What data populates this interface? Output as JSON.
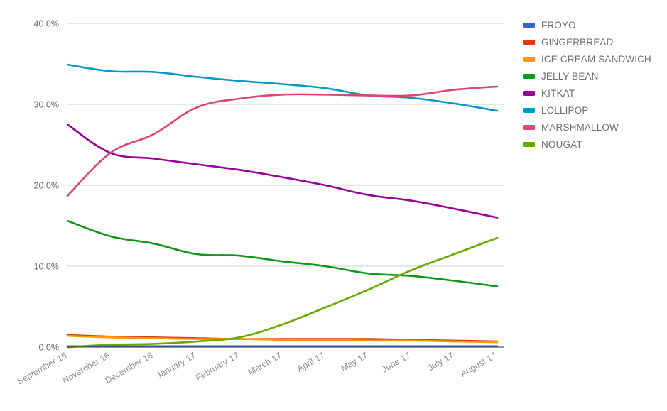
{
  "chart_data": {
    "type": "line",
    "title": "",
    "subtitle": "",
    "xlabel": "",
    "ylabel": "",
    "ylim": [
      0,
      40
    ],
    "ytick_labels": [
      "0.0%",
      "10.0%",
      "20.0%",
      "30.0%",
      "40.0%"
    ],
    "ytick_values": [
      0,
      10,
      20,
      30,
      40
    ],
    "grid": true,
    "legend_position": "right",
    "categories": [
      "September 16",
      "November 16",
      "December 16",
      "January 17",
      "February 17",
      "March 17",
      "April 17",
      "May 17",
      "June 17",
      "July 17",
      "August 17"
    ],
    "series": [
      {
        "name": "FROYO",
        "color": "#3366cc",
        "values": [
          0.1,
          0.1,
          0.1,
          0.1,
          0.1,
          0.1,
          0.1,
          0.1,
          0.1,
          0.1,
          0.1
        ]
      },
      {
        "name": "GINGERBREAD",
        "color": "#dc3912",
        "values": [
          1.5,
          1.3,
          1.2,
          1.1,
          1.0,
          1.0,
          1.0,
          1.0,
          0.9,
          0.8,
          0.7
        ]
      },
      {
        "name": "ICE CREAM SANDWICH",
        "color": "#ff9900",
        "values": [
          1.4,
          1.2,
          1.1,
          1.0,
          1.0,
          0.9,
          0.9,
          0.8,
          0.8,
          0.7,
          0.6
        ]
      },
      {
        "name": "JELLY BEAN",
        "color": "#109618",
        "values": [
          15.6,
          13.7,
          12.8,
          11.5,
          11.3,
          10.6,
          10.0,
          9.1,
          8.8,
          8.2,
          7.5
        ]
      },
      {
        "name": "KITKAT",
        "color": "#990099",
        "values": [
          27.5,
          24.0,
          23.3,
          22.6,
          21.9,
          21.0,
          20.0,
          18.8,
          18.1,
          17.1,
          16.0
        ]
      },
      {
        "name": "LOLLIPOP",
        "color": "#0099c6",
        "values": [
          34.9,
          34.1,
          34.0,
          33.4,
          32.9,
          32.5,
          32.0,
          31.1,
          30.8,
          30.1,
          29.2
        ]
      },
      {
        "name": "MARSHMALLOW",
        "color": "#dd4477",
        "values": [
          18.7,
          24.0,
          26.3,
          29.6,
          30.7,
          31.2,
          31.2,
          31.1,
          31.1,
          31.8,
          32.2
        ]
      },
      {
        "name": "NOUGAT",
        "color": "#66aa00",
        "values": [
          0.0,
          0.3,
          0.4,
          0.7,
          1.2,
          2.8,
          4.9,
          7.1,
          9.5,
          11.5,
          13.5
        ]
      }
    ]
  },
  "legend": {
    "items": [
      {
        "label": "FROYO",
        "color": "#3366cc"
      },
      {
        "label": "GINGERBREAD",
        "color": "#dc3912"
      },
      {
        "label": "ICE CREAM SANDWICH",
        "color": "#ff9900"
      },
      {
        "label": "JELLY BEAN",
        "color": "#109618"
      },
      {
        "label": "KITKAT",
        "color": "#990099"
      },
      {
        "label": "LOLLIPOP",
        "color": "#0099c6"
      },
      {
        "label": "MARSHMALLOW",
        "color": "#dd4477"
      },
      {
        "label": "NOUGAT",
        "color": "#66aa00"
      }
    ]
  }
}
